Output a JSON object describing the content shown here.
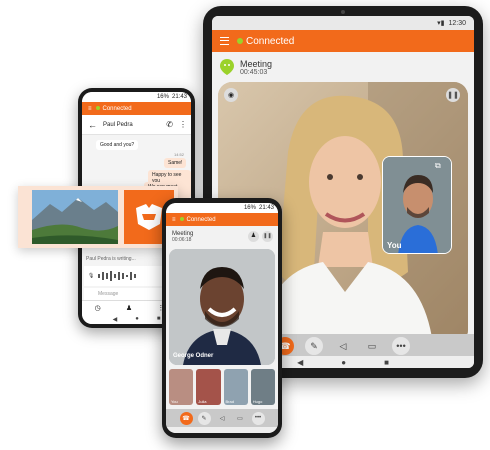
{
  "colors": {
    "brand": "#f26a1b",
    "online": "#9bd22a"
  },
  "tablet": {
    "status_time": "12:30",
    "connected_label": "Connected",
    "meeting_title": "Meeting",
    "meeting_timer": "00:45:03",
    "pip_label": "You",
    "icons": [
      "menu-icon",
      "status-dot-icon",
      "mic-off-icon",
      "pause-icon",
      "switch-camera-icon",
      "hangup-icon",
      "mute-icon",
      "speaker-icon",
      "camera-icon",
      "more-icon"
    ]
  },
  "phone_back": {
    "status_time": "21:43",
    "status_battery": "16%",
    "connected_label": "Connected",
    "contact_name": "Paul Pedra",
    "messages": [
      {
        "from": "other",
        "text": "Good and you?"
      },
      {
        "from": "me",
        "time": "14:52",
        "text": "Same!"
      },
      {
        "from": "me",
        "text": "Happy to see you"
      },
      {
        "from": "me",
        "text": "We can meet here"
      }
    ],
    "typing_text": "Paul Pedra is writing...",
    "message_placeholder": "Message"
  },
  "phone_front": {
    "status_time": "21:43",
    "status_battery": "16%",
    "connected_label": "Connected",
    "meeting_title": "Meeting",
    "meeting_timer": "00:06:18",
    "main_participant": "George Odner",
    "participants": [
      "You",
      "Julia",
      "Brad",
      "Hugo"
    ]
  }
}
